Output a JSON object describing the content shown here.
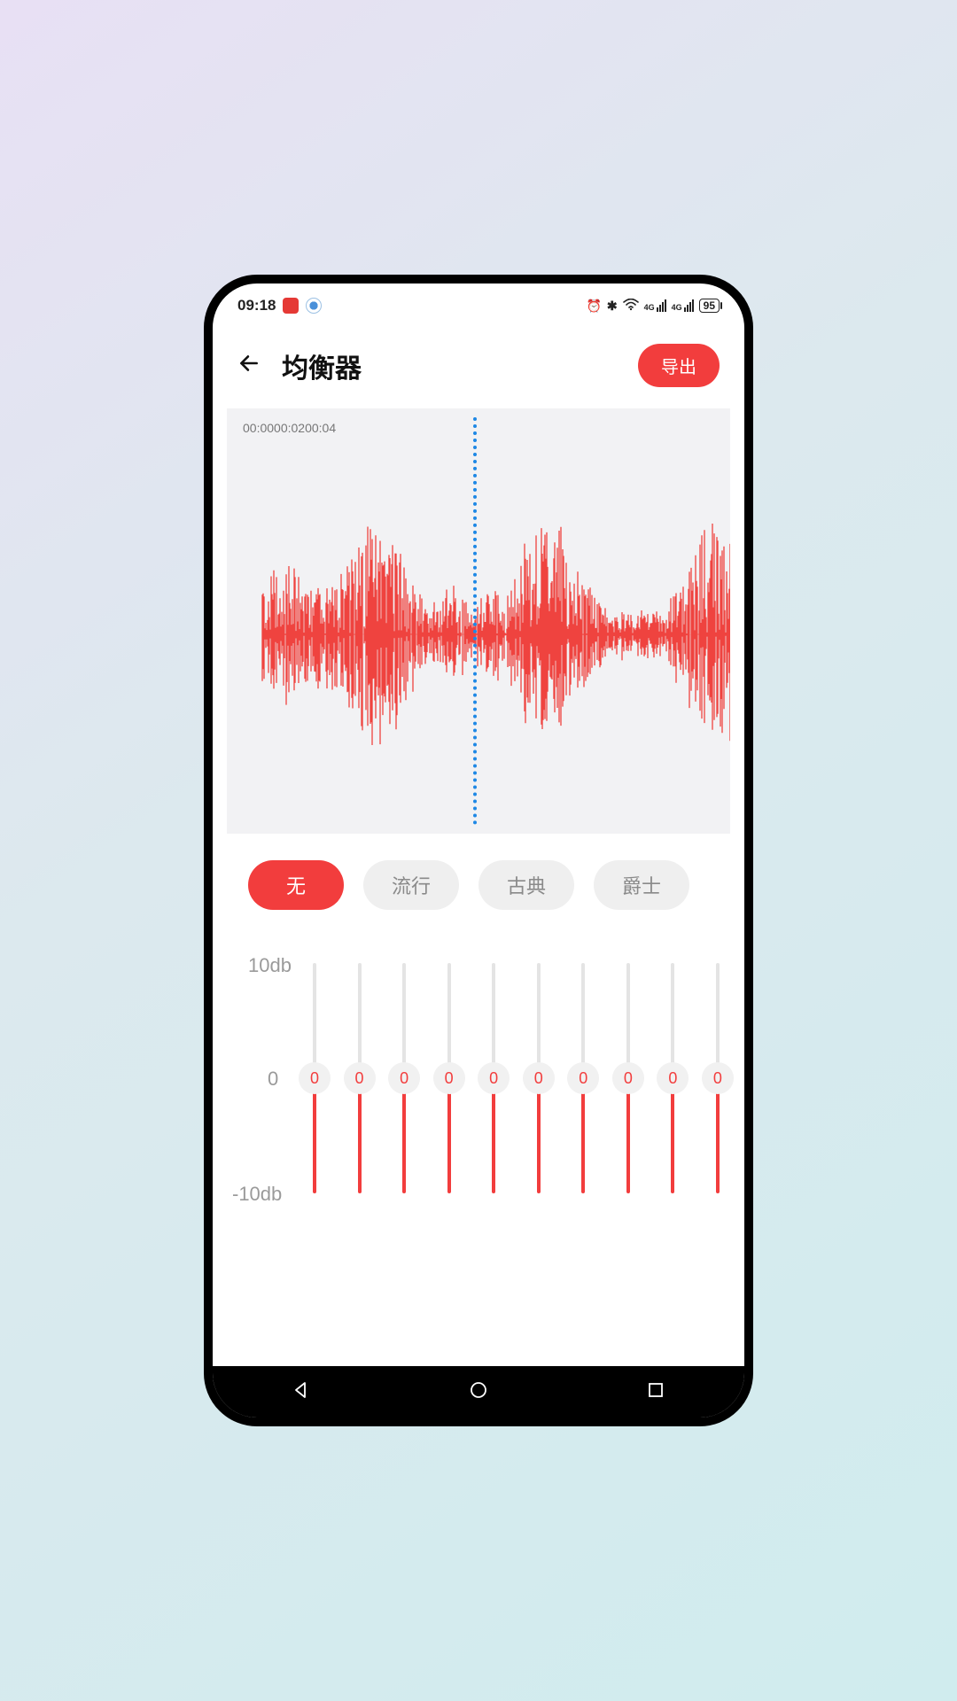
{
  "status": {
    "time": "09:18",
    "battery": "95",
    "net1": "4G",
    "net2": "4G"
  },
  "header": {
    "title": "均衡器",
    "export_label": "导出"
  },
  "timeline": {
    "t0": "00:00",
    "t1": "00:02",
    "t2": "00:04"
  },
  "presets": [
    {
      "label": "无",
      "active": true
    },
    {
      "label": "流行",
      "active": false
    },
    {
      "label": "古典",
      "active": false
    },
    {
      "label": "爵士",
      "active": false
    }
  ],
  "eq": {
    "ytop": "10db",
    "yzero": "0",
    "ybot": "-10db",
    "bands": [
      {
        "value": "0"
      },
      {
        "value": "0"
      },
      {
        "value": "0"
      },
      {
        "value": "0"
      },
      {
        "value": "0"
      },
      {
        "value": "0"
      },
      {
        "value": "0"
      },
      {
        "value": "0"
      },
      {
        "value": "0"
      },
      {
        "value": "0"
      }
    ]
  },
  "colors": {
    "accent": "#f23d3d",
    "playhead": "#1e88e5"
  }
}
